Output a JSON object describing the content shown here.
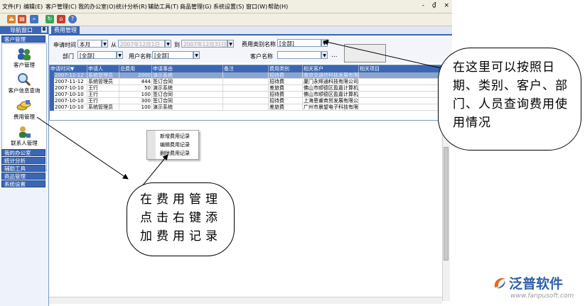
{
  "menu": {
    "items": [
      "文件(F)",
      "编辑(E)",
      "客户管理(C)",
      "我的办公室(O)",
      "统计分析(R)",
      "辅助工具(T)",
      "商品管理(G)",
      "系统设置(S)",
      "窗口(W)",
      "帮助(H)"
    ],
    "window_controls": "- ₫ ×"
  },
  "toolbar": {
    "icons": [
      "exit-icon",
      "print-icon",
      "search-icon",
      "refresh-icon",
      "home-icon",
      "help-icon"
    ]
  },
  "nav": {
    "title": "导航窗口",
    "pin": "◘",
    "section_active": "客户管理",
    "items": [
      {
        "label": "客户管理",
        "icon": "people-icon"
      },
      {
        "label": "客户信息查询",
        "icon": "magnifier-icon"
      },
      {
        "label": "费用管理",
        "icon": "coins-icon"
      },
      {
        "label": "联系人管理",
        "icon": "contact-icon"
      }
    ],
    "sections": [
      "我的办公室",
      "统计分析",
      "辅助工具",
      "商品管理",
      "系统设置"
    ]
  },
  "tab": {
    "label": "费用管理"
  },
  "filters": {
    "apply_time_label": "申请时间",
    "apply_time_value": "本月",
    "from_label": "从",
    "from_date": "2007年12月1日",
    "to_label": "到",
    "to_date": "2007年12月31日",
    "expense_type_label": "费用类别名称",
    "expense_type_value": "[全部]",
    "dept_label": "部门",
    "dept_value": "[全部]",
    "user_label": "用户名称",
    "user_value": "[全部]",
    "customer_label": "客户名称",
    "customer_value": "",
    "ellipsis": "..."
  },
  "grid": {
    "columns": [
      "申请时间▼",
      "申请人",
      "总费用",
      "申请事由",
      "备注",
      "费用类别",
      "相关客户",
      "相关项目"
    ],
    "rows": [
      [
        "2007-11-12",
        "系统管理员",
        "2000",
        "演示系统",
        "",
        "招待费",
        "南京交通信科技发展有限",
        ""
      ],
      [
        "2007-11-12",
        "系统管理员",
        "444",
        "签订合同",
        "",
        "招待费",
        "厦门永辉通科技有限公司",
        ""
      ],
      [
        "2007-10-10",
        "王行",
        "50",
        "演示系统",
        "",
        "差旅费",
        "佛山市顺德区盈嘉计算机",
        ""
      ],
      [
        "2007-10-10",
        "王行",
        "100",
        "签订合同",
        "",
        "招待费",
        "佛山市顺德区盈嘉计算机",
        ""
      ],
      [
        "2007-10-10",
        "王行",
        "300",
        "签订合同",
        "",
        "招待费",
        "上海恩睿商贸发展有限公",
        ""
      ],
      [
        "2007-10-10",
        "系统管理员",
        "100",
        "演示系统",
        "",
        "差旅费",
        "广州市晨望电子科技有限",
        ""
      ]
    ]
  },
  "context_menu": {
    "items": [
      "新增费用记录",
      "编辑费用记录",
      "删除费用记录"
    ]
  },
  "callouts": {
    "filter_hint": "在这里可以按照日期、类别、客户、部门、人员查询费用使用情况",
    "rightclick_hint": "在费用管理点击右键添加费用记录"
  },
  "logo": {
    "text": "泛普软件",
    "url": "www.fanpusoft.com"
  },
  "colors": {
    "header_blue": "#3a66b4",
    "selected_row": "#8aa4ce",
    "logo_blue": "#2f5fa8"
  }
}
